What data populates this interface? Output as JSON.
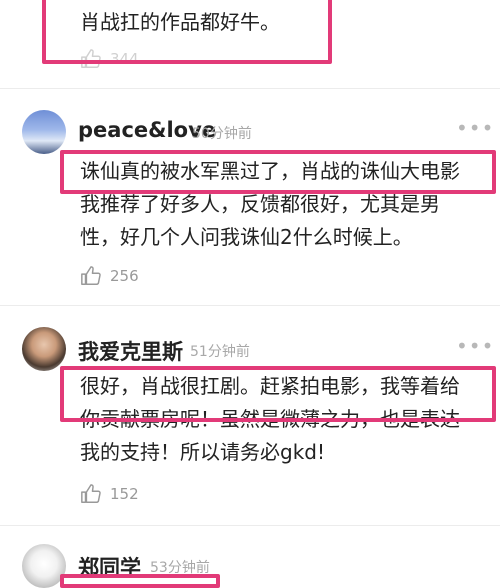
{
  "colors": {
    "highlight": "#e23a78",
    "muted": "#a8a8a8"
  },
  "top_comment": {
    "text": "肖战扛的作品都好牛。",
    "likes": "344"
  },
  "comments": [
    {
      "username": "peace&love",
      "time": "50分钟前",
      "lines": [
        "诛仙真的被水军黑过了，肖战的诛仙大电影",
        "我推荐了好多人，反馈都很好，尤其是男",
        "性，好几个人问我诛仙2什么时候上。"
      ],
      "likes": "256"
    },
    {
      "username": "我爱克里斯",
      "time": "51分钟前",
      "lines": [
        "很好，肖战很扛剧。赶紧拍电影，我等着给",
        "你贡献票房呢！虽然是微薄之力，也是表达",
        "我的支持！所以请务必gkd!"
      ],
      "likes": "152"
    },
    {
      "username": "郑同学",
      "time": "53分钟前"
    }
  ],
  "more_icon": "more-dots-icon",
  "like_icon": "thumbs-up-icon"
}
